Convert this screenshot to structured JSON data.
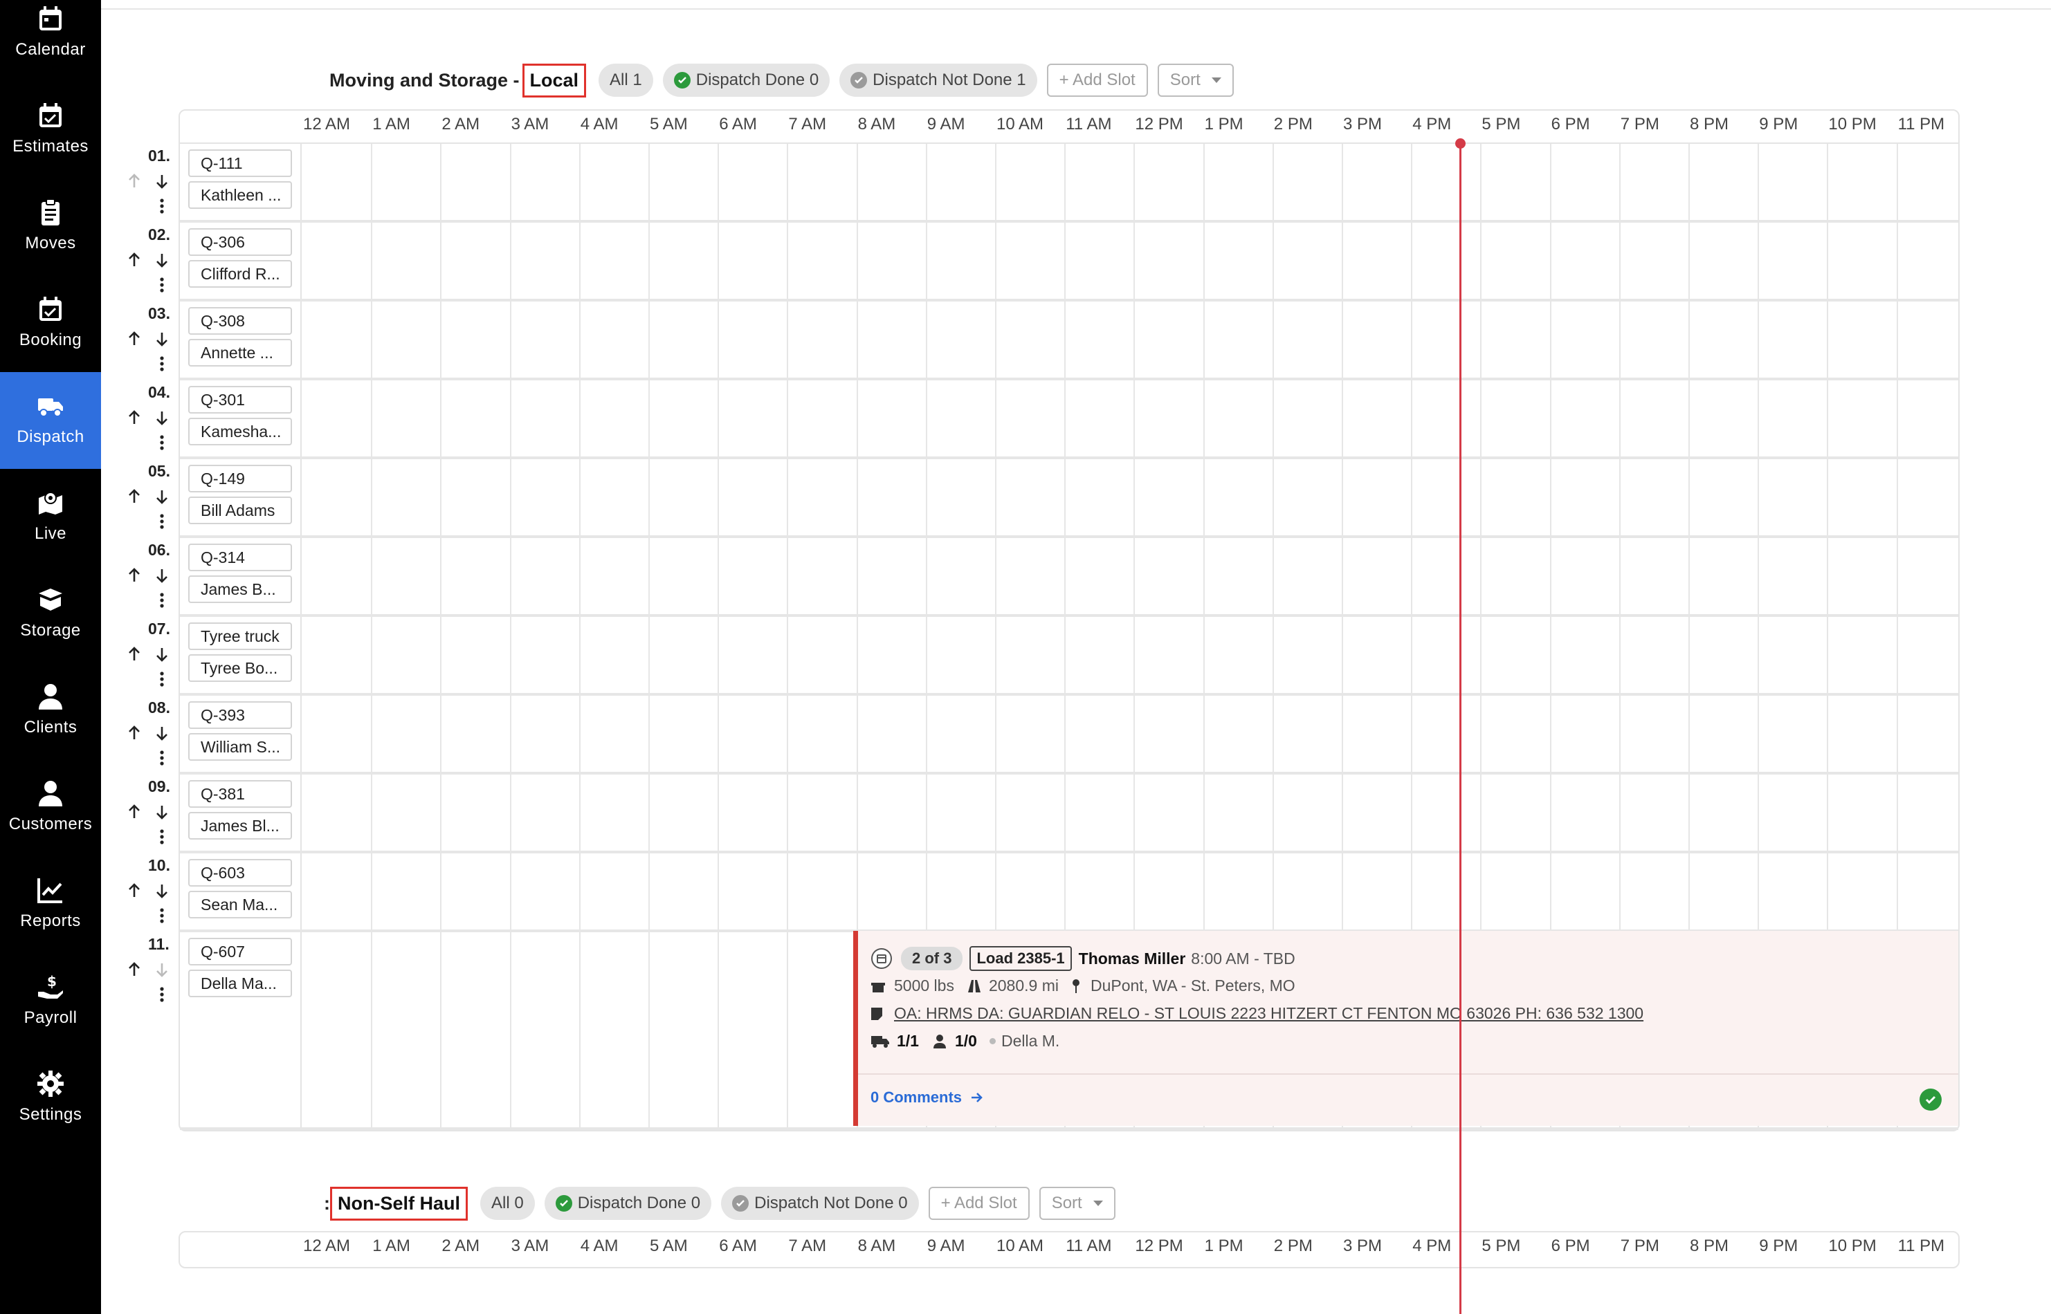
{
  "nav": [
    {
      "label": "Calendar",
      "icon": "calendar-icon"
    },
    {
      "label": "Estimates",
      "icon": "calendar-check-icon"
    },
    {
      "label": "Moves",
      "icon": "clipboard-icon"
    },
    {
      "label": "Booking",
      "icon": "calendar-check-icon"
    },
    {
      "label": "Dispatch",
      "icon": "truck-icon",
      "active": true
    },
    {
      "label": "Live",
      "icon": "map-pin-icon"
    },
    {
      "label": "Storage",
      "icon": "box-icon"
    },
    {
      "label": "Clients",
      "icon": "user-icon"
    },
    {
      "label": "Customers",
      "icon": "user-icon"
    },
    {
      "label": "Reports",
      "icon": "chart-icon"
    },
    {
      "label": "Payroll",
      "icon": "hand-dollar-icon"
    },
    {
      "label": "Settings",
      "icon": "gear-icon"
    }
  ],
  "hours": [
    "12 AM",
    "1 AM",
    "2 AM",
    "3 AM",
    "4 AM",
    "5 AM",
    "6 AM",
    "7 AM",
    "8 AM",
    "9 AM",
    "10 AM",
    "11 AM",
    "12 PM",
    "1 PM",
    "2 PM",
    "3 PM",
    "4 PM",
    "5 PM",
    "6 PM",
    "7 PM",
    "8 PM",
    "9 PM",
    "10 PM",
    "11 PM"
  ],
  "section1": {
    "title": "Moving and Storage -",
    "name": "Local",
    "all": "All 1",
    "dispatch_done": "Dispatch Done 0",
    "dispatch_not_done": "Dispatch Not Done 1",
    "add_slot": "+ Add Slot",
    "sort": "Sort"
  },
  "section2": {
    "title": ":",
    "name": "Non-Self Haul",
    "all": "All 0",
    "dispatch_done": "Dispatch Done 0",
    "dispatch_not_done": "Dispatch Not Done 0",
    "add_slot": "+ Add Slot",
    "sort": "Sort"
  },
  "rows": [
    {
      "num": "01.",
      "truck": "Q-111",
      "crew": "Kathleen ..."
    },
    {
      "num": "02.",
      "truck": "Q-306",
      "crew": "Clifford R..."
    },
    {
      "num": "03.",
      "truck": "Q-308",
      "crew": "Annette ..."
    },
    {
      "num": "04.",
      "truck": "Q-301",
      "crew": "Kamesha..."
    },
    {
      "num": "05.",
      "truck": "Q-149",
      "crew": "Bill Adams"
    },
    {
      "num": "06.",
      "truck": "Q-314",
      "crew": "James B..."
    },
    {
      "num": "07.",
      "truck": "Tyree truck",
      "crew": "Tyree Bo..."
    },
    {
      "num": "08.",
      "truck": "Q-393",
      "crew": "William S..."
    },
    {
      "num": "09.",
      "truck": "Q-381",
      "crew": "James Bl..."
    },
    {
      "num": "10.",
      "truck": "Q-603",
      "crew": "Sean Ma..."
    },
    {
      "num": "11.",
      "truck": "Q-607",
      "crew": "Della Ma..."
    }
  ],
  "job": {
    "count": "2 of 3",
    "load": "Load 2385-1",
    "customer": "Thomas Miller",
    "time": "8:00 AM - TBD",
    "weight": "5000 lbs",
    "distance": "2080.9 mi",
    "route": "DuPont, WA - St. Peters, MO",
    "note": "OA: HRMS DA: GUARDIAN RELO - ST LOUIS 2223 HITZERT CT FENTON MO 63026 PH: 636 532 1300",
    "trucks": "1/1",
    "crew": "1/0",
    "driver": "Della M.",
    "comments": "0 Comments"
  }
}
